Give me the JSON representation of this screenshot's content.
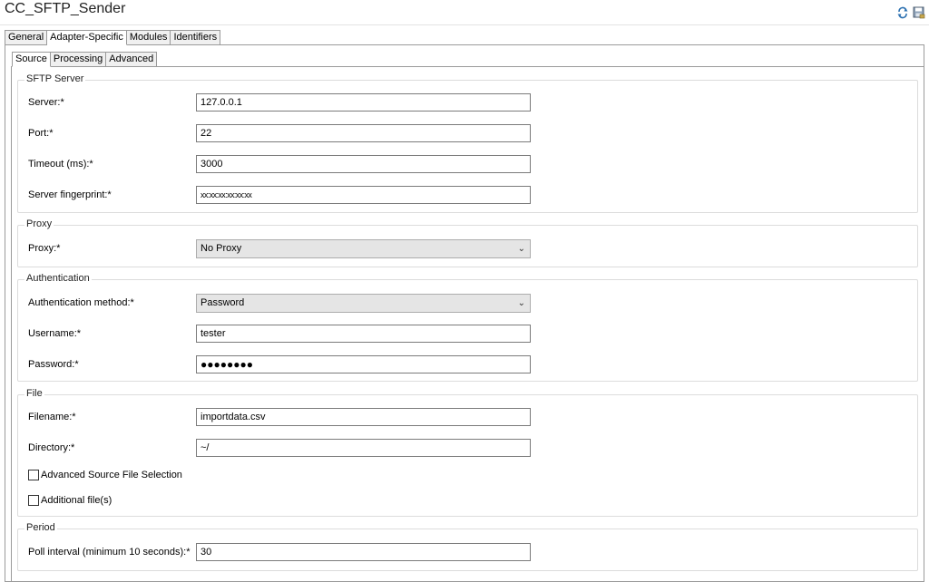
{
  "window": {
    "title": "CC_SFTP_Sender"
  },
  "icons": {
    "refresh": "refresh-icon",
    "save": "save-icon"
  },
  "tabs": [
    "General",
    "Adapter-Specific",
    "Modules",
    "Identifiers"
  ],
  "subtabs": [
    "Source",
    "Processing",
    "Advanced"
  ],
  "groups": {
    "sftp_server": {
      "legend": "SFTP Server",
      "server_label": "Server:*",
      "server_value": "127.0.0.1",
      "port_label": "Port:*",
      "port_value": "22",
      "timeout_label": "Timeout (ms):*",
      "timeout_value": "3000",
      "fingerprint_label": "Server fingerprint:*",
      "fingerprint_value": "xx:xx:xx:xx:xx:xx"
    },
    "proxy": {
      "legend": "Proxy",
      "proxy_label": "Proxy:*",
      "proxy_value": "No Proxy"
    },
    "authentication": {
      "legend": "Authentication",
      "method_label": "Authentication method:*",
      "method_value": "Password",
      "username_label": "Username:*",
      "username_value": "tester",
      "password_label": "Password:*",
      "password_value": "●●●●●●●●"
    },
    "file": {
      "legend": "File",
      "filename_label": "Filename:*",
      "filename_value": "importdata.csv",
      "directory_label": "Directory:*",
      "directory_value": "~/",
      "advanced_selection_label": "Advanced Source File Selection",
      "additional_files_label": "Additional file(s)"
    },
    "period": {
      "legend": "Period",
      "poll_label": "Poll interval (minimum 10 seconds):*",
      "poll_value": "30"
    }
  }
}
